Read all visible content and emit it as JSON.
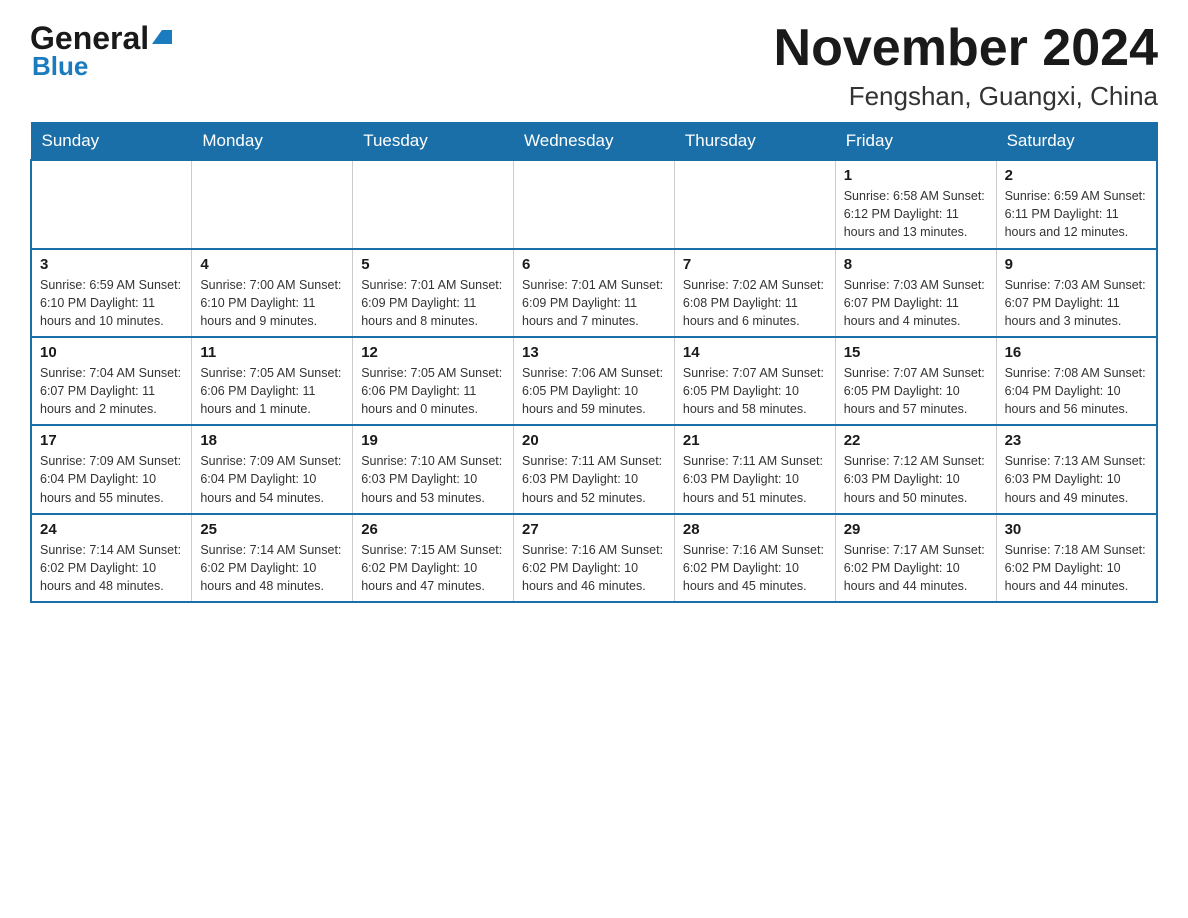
{
  "logo": {
    "general": "General",
    "blue": "Blue",
    "arrow": "▶"
  },
  "title": "November 2024",
  "subtitle": "Fengshan, Guangxi, China",
  "days_of_week": [
    "Sunday",
    "Monday",
    "Tuesday",
    "Wednesday",
    "Thursday",
    "Friday",
    "Saturday"
  ],
  "weeks": [
    [
      {
        "day": "",
        "info": ""
      },
      {
        "day": "",
        "info": ""
      },
      {
        "day": "",
        "info": ""
      },
      {
        "day": "",
        "info": ""
      },
      {
        "day": "",
        "info": ""
      },
      {
        "day": "1",
        "info": "Sunrise: 6:58 AM\nSunset: 6:12 PM\nDaylight: 11 hours and 13 minutes."
      },
      {
        "day": "2",
        "info": "Sunrise: 6:59 AM\nSunset: 6:11 PM\nDaylight: 11 hours and 12 minutes."
      }
    ],
    [
      {
        "day": "3",
        "info": "Sunrise: 6:59 AM\nSunset: 6:10 PM\nDaylight: 11 hours and 10 minutes."
      },
      {
        "day": "4",
        "info": "Sunrise: 7:00 AM\nSunset: 6:10 PM\nDaylight: 11 hours and 9 minutes."
      },
      {
        "day": "5",
        "info": "Sunrise: 7:01 AM\nSunset: 6:09 PM\nDaylight: 11 hours and 8 minutes."
      },
      {
        "day": "6",
        "info": "Sunrise: 7:01 AM\nSunset: 6:09 PM\nDaylight: 11 hours and 7 minutes."
      },
      {
        "day": "7",
        "info": "Sunrise: 7:02 AM\nSunset: 6:08 PM\nDaylight: 11 hours and 6 minutes."
      },
      {
        "day": "8",
        "info": "Sunrise: 7:03 AM\nSunset: 6:07 PM\nDaylight: 11 hours and 4 minutes."
      },
      {
        "day": "9",
        "info": "Sunrise: 7:03 AM\nSunset: 6:07 PM\nDaylight: 11 hours and 3 minutes."
      }
    ],
    [
      {
        "day": "10",
        "info": "Sunrise: 7:04 AM\nSunset: 6:07 PM\nDaylight: 11 hours and 2 minutes."
      },
      {
        "day": "11",
        "info": "Sunrise: 7:05 AM\nSunset: 6:06 PM\nDaylight: 11 hours and 1 minute."
      },
      {
        "day": "12",
        "info": "Sunrise: 7:05 AM\nSunset: 6:06 PM\nDaylight: 11 hours and 0 minutes."
      },
      {
        "day": "13",
        "info": "Sunrise: 7:06 AM\nSunset: 6:05 PM\nDaylight: 10 hours and 59 minutes."
      },
      {
        "day": "14",
        "info": "Sunrise: 7:07 AM\nSunset: 6:05 PM\nDaylight: 10 hours and 58 minutes."
      },
      {
        "day": "15",
        "info": "Sunrise: 7:07 AM\nSunset: 6:05 PM\nDaylight: 10 hours and 57 minutes."
      },
      {
        "day": "16",
        "info": "Sunrise: 7:08 AM\nSunset: 6:04 PM\nDaylight: 10 hours and 56 minutes."
      }
    ],
    [
      {
        "day": "17",
        "info": "Sunrise: 7:09 AM\nSunset: 6:04 PM\nDaylight: 10 hours and 55 minutes."
      },
      {
        "day": "18",
        "info": "Sunrise: 7:09 AM\nSunset: 6:04 PM\nDaylight: 10 hours and 54 minutes."
      },
      {
        "day": "19",
        "info": "Sunrise: 7:10 AM\nSunset: 6:03 PM\nDaylight: 10 hours and 53 minutes."
      },
      {
        "day": "20",
        "info": "Sunrise: 7:11 AM\nSunset: 6:03 PM\nDaylight: 10 hours and 52 minutes."
      },
      {
        "day": "21",
        "info": "Sunrise: 7:11 AM\nSunset: 6:03 PM\nDaylight: 10 hours and 51 minutes."
      },
      {
        "day": "22",
        "info": "Sunrise: 7:12 AM\nSunset: 6:03 PM\nDaylight: 10 hours and 50 minutes."
      },
      {
        "day": "23",
        "info": "Sunrise: 7:13 AM\nSunset: 6:03 PM\nDaylight: 10 hours and 49 minutes."
      }
    ],
    [
      {
        "day": "24",
        "info": "Sunrise: 7:14 AM\nSunset: 6:02 PM\nDaylight: 10 hours and 48 minutes."
      },
      {
        "day": "25",
        "info": "Sunrise: 7:14 AM\nSunset: 6:02 PM\nDaylight: 10 hours and 48 minutes."
      },
      {
        "day": "26",
        "info": "Sunrise: 7:15 AM\nSunset: 6:02 PM\nDaylight: 10 hours and 47 minutes."
      },
      {
        "day": "27",
        "info": "Sunrise: 7:16 AM\nSunset: 6:02 PM\nDaylight: 10 hours and 46 minutes."
      },
      {
        "day": "28",
        "info": "Sunrise: 7:16 AM\nSunset: 6:02 PM\nDaylight: 10 hours and 45 minutes."
      },
      {
        "day": "29",
        "info": "Sunrise: 7:17 AM\nSunset: 6:02 PM\nDaylight: 10 hours and 44 minutes."
      },
      {
        "day": "30",
        "info": "Sunrise: 7:18 AM\nSunset: 6:02 PM\nDaylight: 10 hours and 44 minutes."
      }
    ]
  ]
}
